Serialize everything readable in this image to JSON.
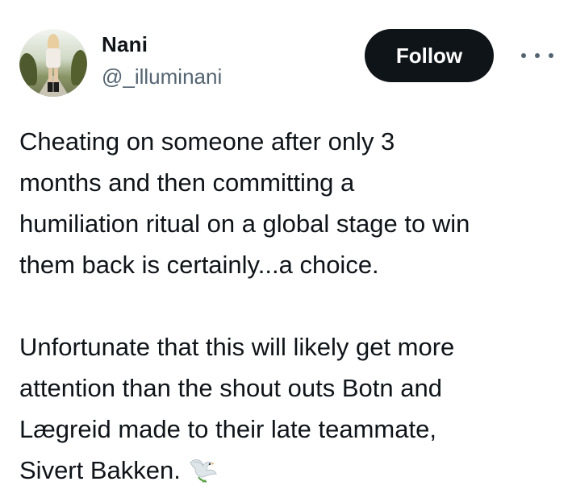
{
  "author": {
    "name": "Nani",
    "handle": "@_illuminani"
  },
  "actions": {
    "follow_label": "Follow",
    "more_icon": "more-horizontal-icon"
  },
  "tweet": {
    "lines_p1": [
      "Cheating on someone after only 3",
      "months and then committing a",
      "humiliation ritual on a global stage to win",
      "them back is certainly...a choice."
    ],
    "lines_p2": [
      "Unfortunate that this will likely get more",
      "attention than the shout outs Botn and",
      "Lægreid made to their late teammate,",
      "Sivert Bakken."
    ],
    "emoji": "dove-icon"
  },
  "colors": {
    "text": "#0f1419",
    "secondary": "#536471",
    "button_bg": "#0f1419",
    "button_text": "#ffffff"
  }
}
